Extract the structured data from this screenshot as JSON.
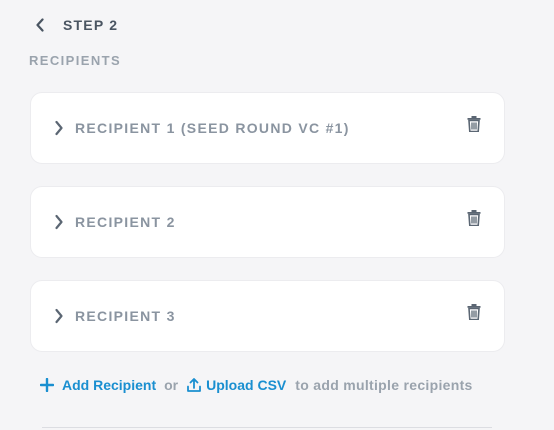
{
  "header": {
    "back_icon": "chevron-left-icon",
    "step_title": "STEP 2"
  },
  "section": {
    "label": "RECIPIENTS"
  },
  "recipients": [
    {
      "name": "RECIPIENT 1 (SEED ROUND VC #1)"
    },
    {
      "name": "RECIPIENT 2"
    },
    {
      "name": "RECIPIENT 3"
    }
  ],
  "actions": {
    "add_label": "Add Recipient",
    "or_text": "or",
    "upload_label": "Upload CSV",
    "tail_text": "to add multiple recipients"
  },
  "colors": {
    "accent": "#1a8fd0",
    "muted_text": "#9aa3ad",
    "title_text": "#4a5562",
    "card_bg": "#ffffff",
    "page_bg": "#f5f5f7"
  }
}
